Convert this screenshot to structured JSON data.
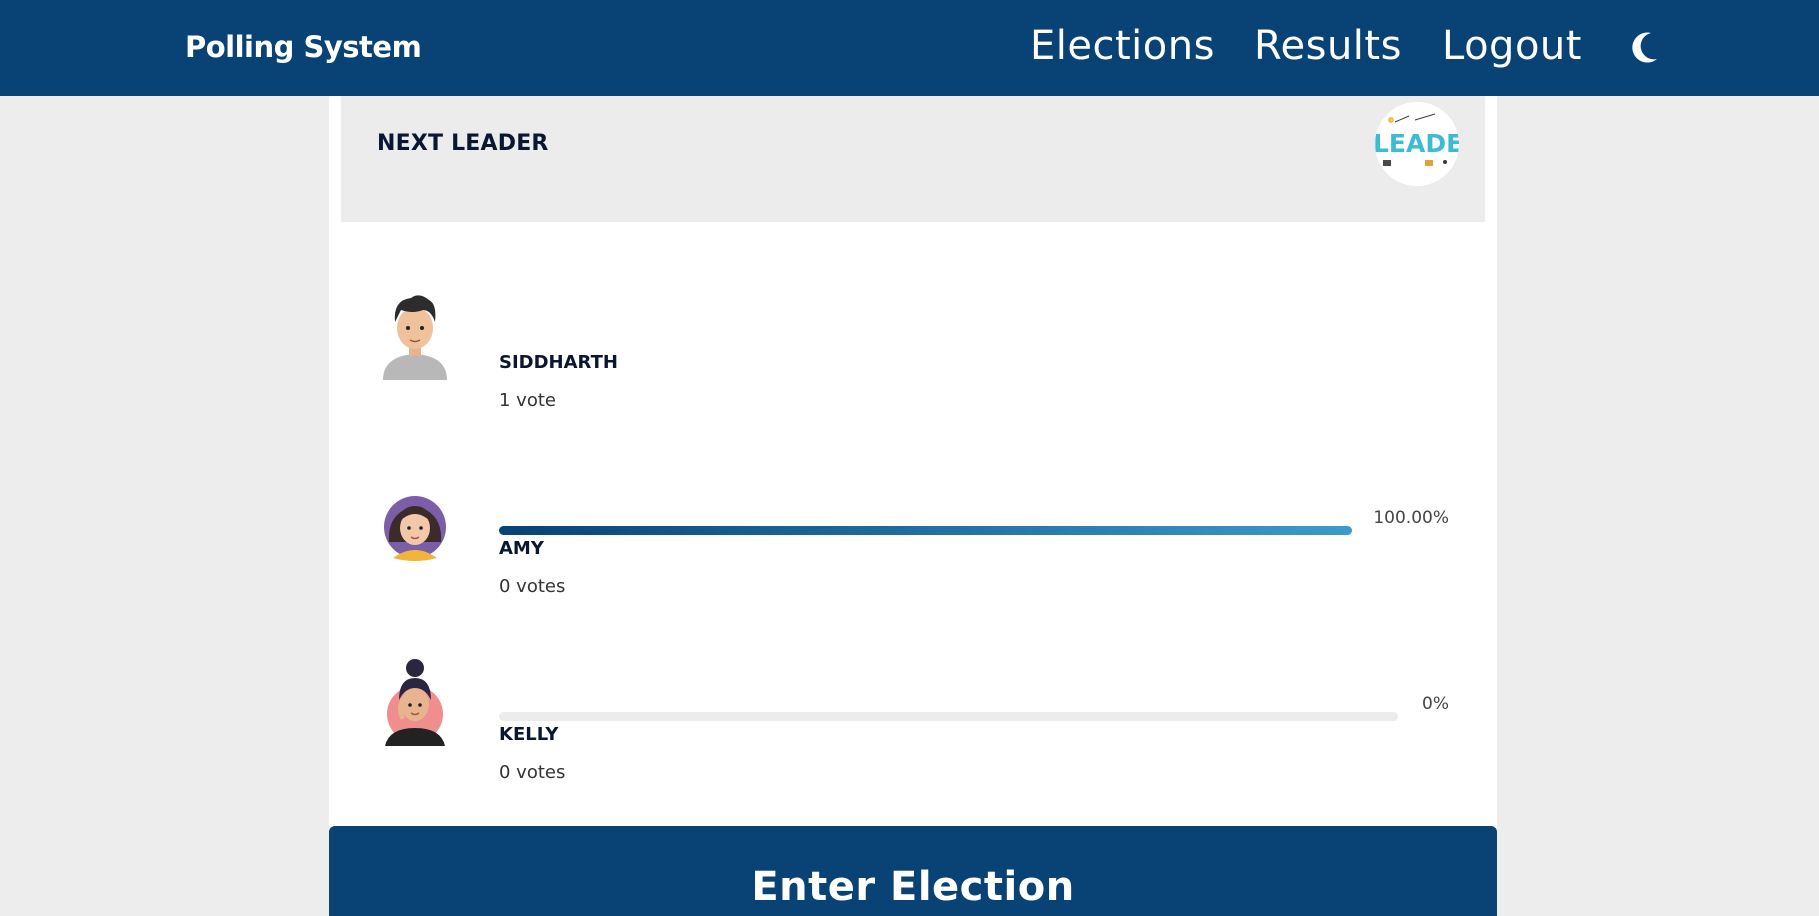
{
  "nav": {
    "brand": "Polling System",
    "links": [
      "Elections",
      "Results",
      "Logout"
    ],
    "theme_toggle_icon": "moon-icon"
  },
  "election": {
    "title": "NEXT LEADER",
    "logo_icon": "leader-logo"
  },
  "candidates": [
    {
      "name": "SIDDHARTH",
      "votes": "1 vote",
      "percent": "100.00%",
      "share": 1.0,
      "avatar_icon": "boy-avatar-icon"
    },
    {
      "name": "AMY",
      "votes": "0 votes",
      "percent": "0%",
      "share": 0.0,
      "avatar_icon": "girl-avatar-icon"
    },
    {
      "name": "KELLY",
      "votes": "0 votes",
      "percent": "0%",
      "share": 0.0,
      "avatar_icon": "woman-avatar-icon"
    }
  ],
  "actions": {
    "enter_label": "Enter Election"
  },
  "colors": {
    "primary": "#094275",
    "accent": "#3c9bcb",
    "page_bg": "#ededed"
  }
}
